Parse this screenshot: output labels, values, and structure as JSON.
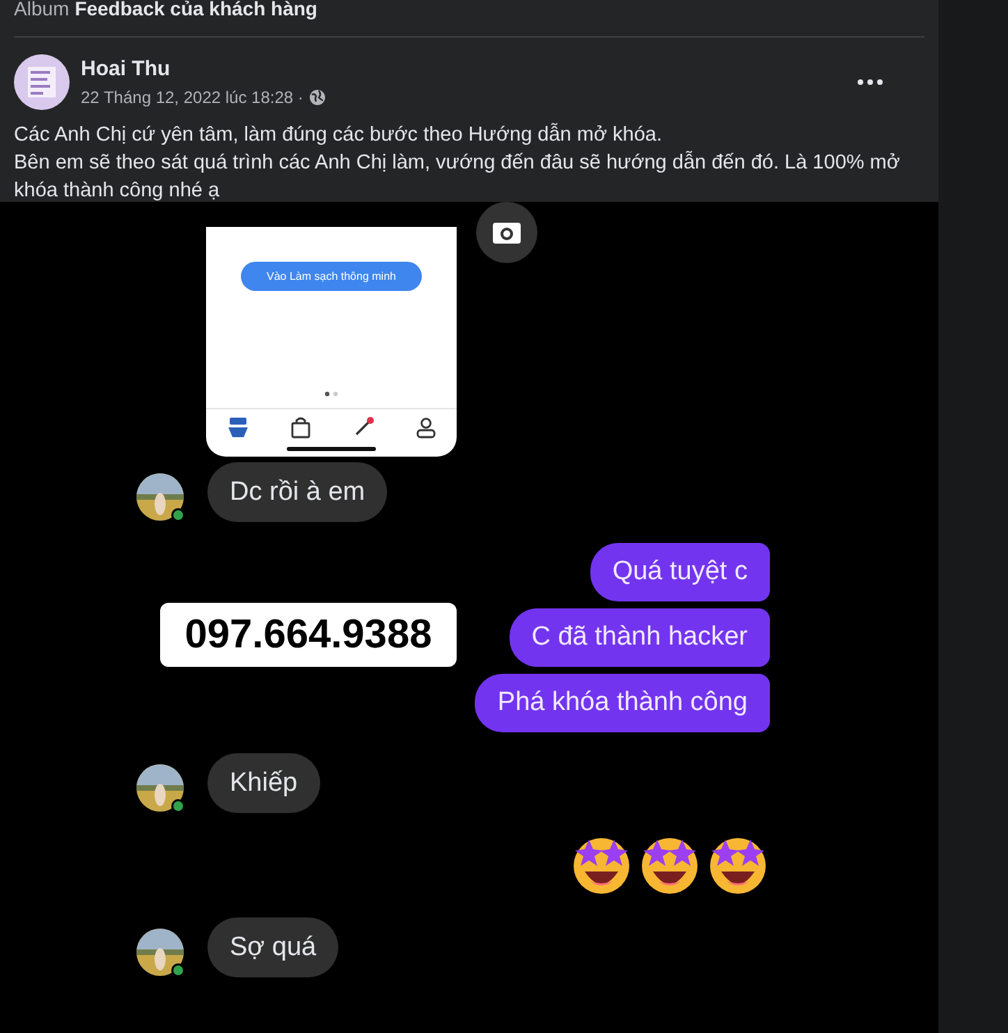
{
  "album": {
    "label": "Album",
    "name": "Feedback của khách hàng"
  },
  "post": {
    "author": "Hoai Thu",
    "timestamp": "22 Tháng 12, 2022 lúc 18:28 ·",
    "paragraphs": [
      "Các Anh Chị cứ yên tâm, làm đúng các bước theo Hướng dẫn mở khóa.",
      "Bên em sẽ theo sát quá trình các Anh Chị làm, vướng đến đâu sẽ hướng dẫn đến đó. Là 100% mở khóa thành công nhé ạ"
    ]
  },
  "photo": {
    "phone_button": "Vào Làm sạch thông minh",
    "messages": [
      {
        "kind": "received",
        "text": "Dc rồi à em"
      },
      {
        "kind": "sent",
        "text": "Quá tuyệt c"
      },
      {
        "kind": "sent",
        "text": "C đã thành hacker"
      },
      {
        "kind": "sent",
        "text": "Phá khóa thành công"
      },
      {
        "kind": "received",
        "text": "Khiếp"
      },
      {
        "kind": "emoji"
      },
      {
        "kind": "received",
        "text": "Sợ quá"
      }
    ],
    "phone_number": "097.664.9388"
  }
}
